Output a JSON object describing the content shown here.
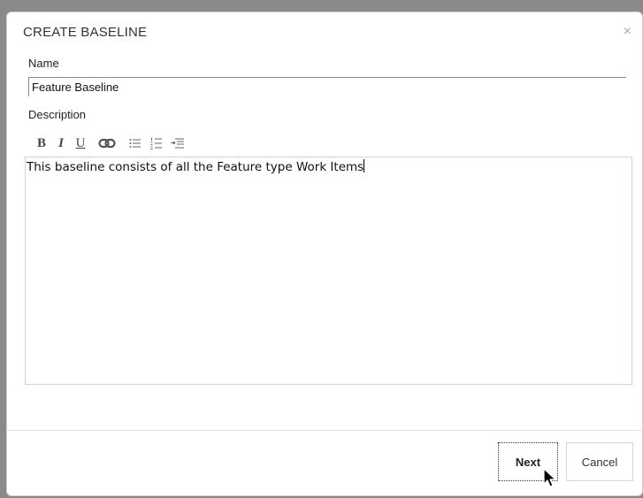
{
  "dialog": {
    "title": "CREATE BASELINE",
    "close_glyph": "×"
  },
  "name_field": {
    "label": "Name",
    "value": "Feature Baseline"
  },
  "description_field": {
    "label": "Description",
    "toolbar": {
      "bold_glyph": "B",
      "italic_glyph": "I",
      "underline_glyph": "U",
      "icons": [
        "link-icon",
        "bulleted-list-icon",
        "numbered-list-icon",
        "indent-icon"
      ]
    },
    "value": "This baseline consists of all the Feature type Work Items"
  },
  "footer": {
    "next_label": "Next",
    "cancel_label": "Cancel"
  },
  "colors": {
    "overlay": "#8a8a8a",
    "dialog_bg": "#ffffff",
    "editor_border": "#c9d3ea"
  }
}
